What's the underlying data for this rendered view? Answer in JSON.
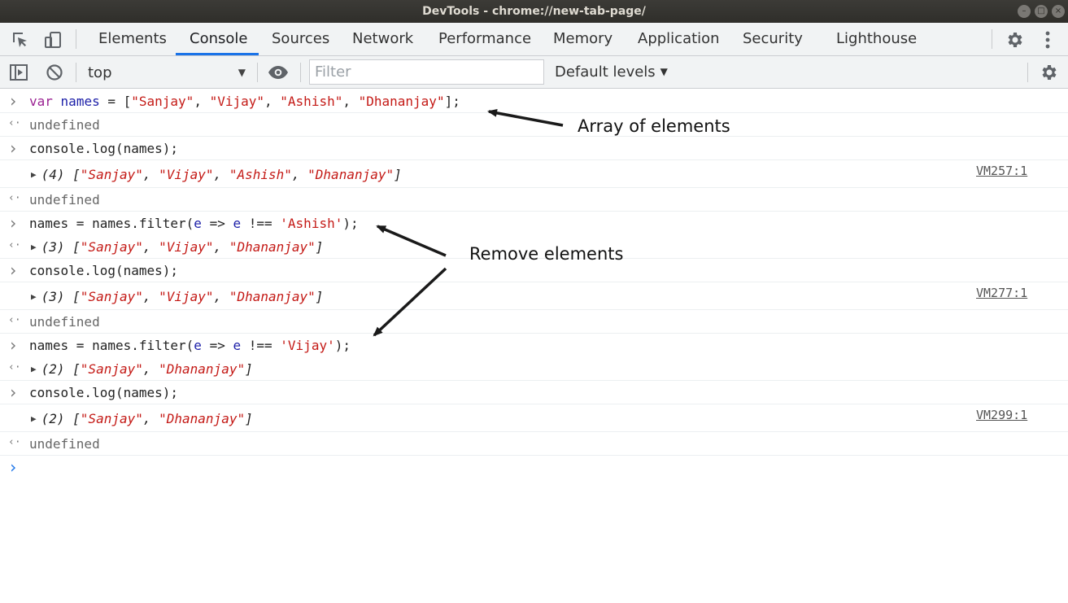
{
  "window": {
    "title": "DevTools - chrome://new-tab-page/",
    "controls": [
      "minimize",
      "maximize",
      "close"
    ]
  },
  "tabs": [
    {
      "label": "Elements"
    },
    {
      "label": "Console",
      "active": true
    },
    {
      "label": "Sources"
    },
    {
      "label": "Network"
    },
    {
      "label": "Performance"
    },
    {
      "label": "Memory"
    },
    {
      "label": "Application"
    },
    {
      "label": "Security"
    },
    {
      "label": "Lighthouse"
    }
  ],
  "toolbar": {
    "context": "top",
    "filter_placeholder": "Filter",
    "levels": "Default levels"
  },
  "console": {
    "lines": [
      {
        "kind": "input",
        "tokens": [
          [
            "kw",
            "var"
          ],
          [
            "t",
            " "
          ],
          [
            "var",
            "names"
          ],
          [
            "t",
            " = ["
          ],
          [
            "str",
            "\"Sanjay\""
          ],
          [
            "t",
            ", "
          ],
          [
            "str",
            "\"Vijay\""
          ],
          [
            "t",
            ", "
          ],
          [
            "str",
            "\"Ashish\""
          ],
          [
            "t",
            ", "
          ],
          [
            "str",
            "\"Dhananjay\""
          ],
          [
            "t",
            "];"
          ]
        ]
      },
      {
        "kind": "return",
        "text": "undefined"
      },
      {
        "kind": "input",
        "tokens": [
          [
            "t",
            "console.log(names);"
          ]
        ]
      },
      {
        "kind": "log",
        "count": "(4)",
        "tokens": [
          [
            "str",
            "\"Sanjay\""
          ],
          [
            "t",
            ", "
          ],
          [
            "str",
            "\"Vijay\""
          ],
          [
            "t",
            ", "
          ],
          [
            "str",
            "\"Ashish\""
          ],
          [
            "t",
            ", "
          ],
          [
            "str",
            "\"Dhananjay\""
          ]
        ],
        "source": "VM257:1"
      },
      {
        "kind": "return",
        "text": "undefined"
      },
      {
        "kind": "input",
        "tokens": [
          [
            "t",
            "names = names.filter("
          ],
          [
            "var",
            "e"
          ],
          [
            "t",
            " => "
          ],
          [
            "var",
            "e"
          ],
          [
            "t",
            " !== "
          ],
          [
            "str",
            "'Ashish'"
          ],
          [
            "t",
            ");"
          ]
        ]
      },
      {
        "kind": "result",
        "count": "(3)",
        "tokens": [
          [
            "str",
            "\"Sanjay\""
          ],
          [
            "t",
            ", "
          ],
          [
            "str",
            "\"Vijay\""
          ],
          [
            "t",
            ", "
          ],
          [
            "str",
            "\"Dhananjay\""
          ]
        ]
      },
      {
        "kind": "input",
        "tokens": [
          [
            "t",
            "console.log(names);"
          ]
        ]
      },
      {
        "kind": "log",
        "count": "(3)",
        "tokens": [
          [
            "str",
            "\"Sanjay\""
          ],
          [
            "t",
            ", "
          ],
          [
            "str",
            "\"Vijay\""
          ],
          [
            "t",
            ", "
          ],
          [
            "str",
            "\"Dhananjay\""
          ]
        ],
        "source": "VM277:1"
      },
      {
        "kind": "return",
        "text": "undefined"
      },
      {
        "kind": "input",
        "tokens": [
          [
            "t",
            "names = names.filter("
          ],
          [
            "var",
            "e"
          ],
          [
            "t",
            " => "
          ],
          [
            "var",
            "e"
          ],
          [
            "t",
            " !== "
          ],
          [
            "str",
            "'Vijay'"
          ],
          [
            "t",
            ");"
          ]
        ]
      },
      {
        "kind": "result",
        "count": "(2)",
        "tokens": [
          [
            "str",
            "\"Sanjay\""
          ],
          [
            "t",
            ", "
          ],
          [
            "str",
            "\"Dhananjay\""
          ]
        ]
      },
      {
        "kind": "input",
        "tokens": [
          [
            "t",
            "console.log(names);"
          ]
        ]
      },
      {
        "kind": "log",
        "count": "(2)",
        "tokens": [
          [
            "str",
            "\"Sanjay\""
          ],
          [
            "t",
            ", "
          ],
          [
            "str",
            "\"Dhananjay\""
          ]
        ],
        "source": "VM299:1"
      },
      {
        "kind": "return",
        "text": "undefined"
      },
      {
        "kind": "prompt"
      }
    ]
  },
  "annotations": {
    "array_label": "Array of elements",
    "remove_label": "Remove elements"
  },
  "colors": {
    "keyword": "#9b2393",
    "variable": "#1c1fa8",
    "string": "#c41a16",
    "active_tab": "#1a73e8",
    "prompt_active": "#1a73e8"
  }
}
